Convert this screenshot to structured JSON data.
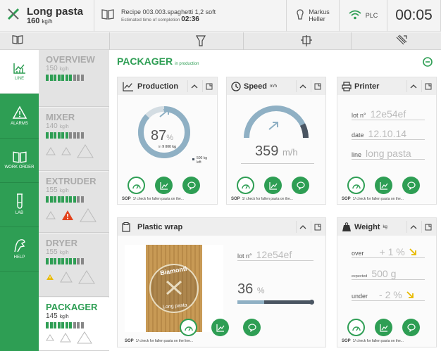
{
  "header": {
    "product": "Long pasta",
    "rate_value": "160",
    "rate_unit": "kg/h",
    "recipe_title": "Recipe 003.003.spaghetti 1,2 soft",
    "eta_label": "Estimated time of completion",
    "eta_value": "02:36",
    "user_first": "Markus",
    "user_last": "Heller",
    "plc_label": "PLC",
    "clock": "00:05"
  },
  "nav": [
    {
      "label": "LINE",
      "icon": "line-chart-icon",
      "active": true
    },
    {
      "label": "ALARMS",
      "icon": "warning-icon",
      "active": false
    },
    {
      "label": "WORK ORDER",
      "icon": "book-icon",
      "active": false
    },
    {
      "label": "LAB",
      "icon": "test-tube-icon",
      "active": false
    },
    {
      "label": "HELP",
      "icon": "hand-icon",
      "active": false
    }
  ],
  "stages": [
    {
      "name": "OVERVIEW",
      "rate": "150",
      "unit": "kg/h",
      "bars_on": 7,
      "bars_total": 10
    },
    {
      "name": "MIXER",
      "rate": "140",
      "unit": "kg/h",
      "bars_on": 6,
      "bars_total": 10
    },
    {
      "name": "EXTRUDER",
      "rate": "155",
      "unit": "kg/h",
      "bars_on": 8,
      "bars_total": 10
    },
    {
      "name": "DRYER",
      "rate": "155",
      "unit": "kg/h",
      "bars_on": 8,
      "bars_total": 10
    },
    {
      "name": "PACKAGER",
      "rate": "145",
      "unit": "kg/h",
      "bars_on": 7,
      "bars_total": 10
    }
  ],
  "main": {
    "title": "PACKAGER",
    "status": "in production"
  },
  "production": {
    "title": "Production",
    "percent": "87",
    "percent_sign": "%",
    "sub_prefix": "in",
    "sub_value": "9 000 kg",
    "left_value": "500 kg",
    "left_label": "left",
    "progress": 0.87
  },
  "speed": {
    "title": "Speed",
    "unit_small": "m/h",
    "value": "359",
    "unit": "m/h",
    "level": 0.85
  },
  "printer": {
    "title": "Printer",
    "lot_label": "lot n°",
    "lot_value": "12e54ef",
    "date_label": "date",
    "date_value": "12.10.14",
    "line_label": "line",
    "line_value": "long pasta"
  },
  "plastic": {
    "title": "Plastic wrap",
    "lot_label": "lot n°",
    "lot_value": "12e54ef",
    "percent": "36",
    "percent_sign": "%",
    "fill": 0.36,
    "brand_text": "Biamonti",
    "brand_sub": "Long pasta"
  },
  "weight": {
    "title": "Weight",
    "unit_small": "kg",
    "over_label": "over",
    "over_value": "+ 1 %",
    "expected_label": "expected",
    "expected_value": "500 g",
    "under_label": "under",
    "under_value": "- 2 %"
  },
  "sop": {
    "label": "SOP",
    "text": "1/ check for fallen pasta on the...",
    "text_long": "1/ check for fallen pasta on the line..."
  },
  "colors": {
    "green": "#2e9e54",
    "warning": "#e8b900",
    "alarm": "#e2421c",
    "gauge_blue": "#8fb0c4",
    "gauge_dark": "#4a5562"
  }
}
